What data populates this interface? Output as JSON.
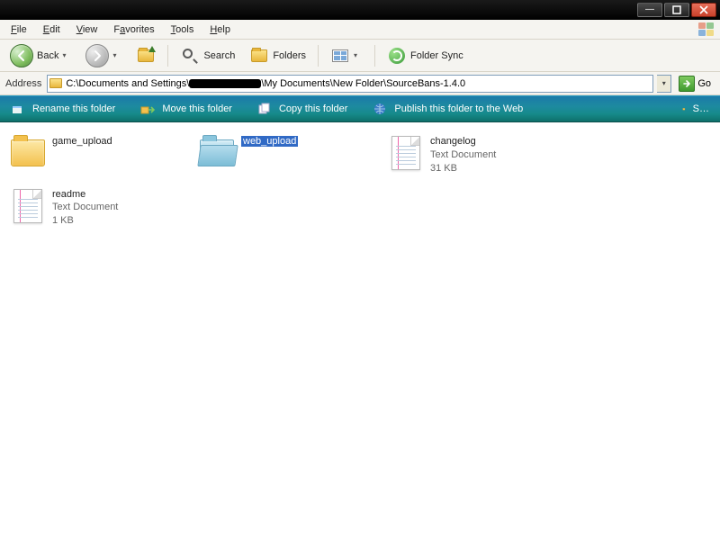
{
  "titlebar": {},
  "menu": {
    "file": "File",
    "edit": "Edit",
    "view": "View",
    "favorites": "Favorites",
    "tools": "Tools",
    "help": "Help"
  },
  "toolbar": {
    "back": "Back",
    "search": "Search",
    "folders": "Folders",
    "foldersync": "Folder Sync"
  },
  "address": {
    "label": "Address",
    "prefix": "C:\\Documents and Settings\\",
    "suffix": "\\My Documents\\New Folder\\SourceBans-1.4.0",
    "go": "Go"
  },
  "tasks": {
    "rename": "Rename this folder",
    "move": "Move this folder",
    "copy": "Copy this folder",
    "publish": "Publish this folder to the Web",
    "share": "S…"
  },
  "items": [
    {
      "name": "game_upload",
      "type": "folder"
    },
    {
      "name": "web_upload",
      "type": "folder",
      "selected": true
    },
    {
      "name": "changelog",
      "type": "text",
      "sub1": "Text Document",
      "sub2": "31 KB"
    },
    {
      "name": "readme",
      "type": "text",
      "sub1": "Text Document",
      "sub2": "1 KB"
    }
  ]
}
